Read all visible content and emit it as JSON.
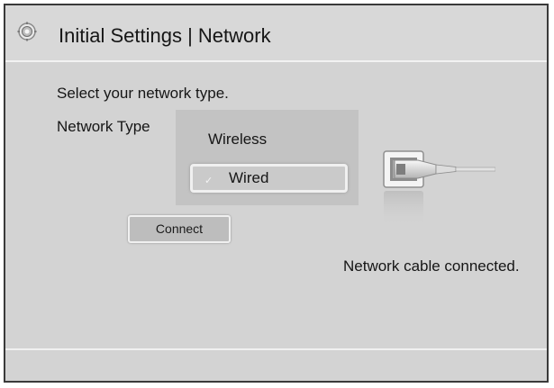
{
  "header": {
    "icon": "gear-icon",
    "title": "Initial Settings | Network"
  },
  "prompt": "Select your network type.",
  "network_type": {
    "label": "Network Type",
    "options": [
      {
        "label": "Wireless",
        "selected": false
      },
      {
        "label": "Wired",
        "selected": true,
        "check": "✓"
      }
    ]
  },
  "connect_button": {
    "label": "Connect"
  },
  "status": {
    "icon": "ethernet-cable-icon",
    "text": "Network cable connected."
  }
}
